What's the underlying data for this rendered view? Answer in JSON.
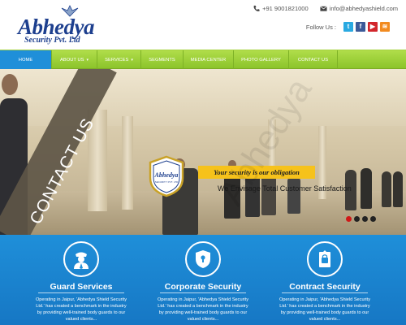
{
  "header": {
    "logo_name": "Abhedya",
    "logo_sub": "Security Pvt. Ltd",
    "phone": "+91 9001821000",
    "email": "info@abhedyashield.com",
    "follow_label": "Follow Us :",
    "social_icons": [
      "twitter-icon",
      "facebook-icon",
      "youtube-icon",
      "rss-icon"
    ]
  },
  "nav": {
    "items": [
      {
        "label": "HOME",
        "active": true
      },
      {
        "label": "ABOUT US",
        "has_caret": true
      },
      {
        "label": "SERVICES",
        "has_caret": true
      },
      {
        "label": "SEGMENTS"
      },
      {
        "label": "MEDIA CENTER"
      },
      {
        "label": "PHOTO GALLERY"
      },
      {
        "label": "CONTACT US"
      }
    ],
    "caret": "▾",
    "accent_color": "#1f8fd9",
    "bar_color": "#9acd32"
  },
  "banner": {
    "side_text": "CONTACT US",
    "badge_text": "Abhedya",
    "badge_sub": "SECURITY PVT. LTD",
    "tagline": "Your security is our obligation",
    "sub_tagline": "We Envisage Total Customer Satisfaction",
    "slides": 4,
    "active_slide": 1,
    "watermark": "Abhedya"
  },
  "services": [
    {
      "title": "Guard Services",
      "icon": "guard-icon",
      "description": "Operating in Jaipur, 'Abhedya Shield Security Ltd.' has created a benchmark in the industry by providing well-trained body guards to our valued clients..."
    },
    {
      "title": "Corporate Security",
      "icon": "shield-lock-icon",
      "description": "Operating in Jaipur, 'Abhedya Shield Security Ltd.' has created a benchmark in the industry by providing well-trained body guards to our valued clients..."
    },
    {
      "title": "Contract Security",
      "icon": "contract-lock-icon",
      "description": "Operating in Jaipur, 'Abhedya Shield Security Ltd.' has created a benchmark in the industry by providing well-trained body guards to our valued clients..."
    }
  ]
}
